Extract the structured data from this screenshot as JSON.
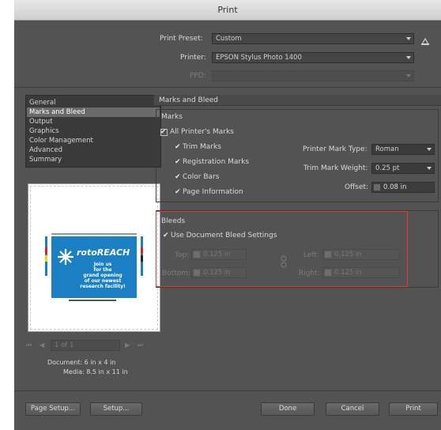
{
  "window": {
    "title": "Print"
  },
  "top": {
    "print_preset_label": "Print Preset:",
    "print_preset_value": "Custom",
    "printer_label": "Printer:",
    "printer_value": "EPSON Stylus Photo 1400",
    "ppd_label": "PPD:",
    "ppd_value": ""
  },
  "categories": [
    "General",
    "Marks and Bleed",
    "Output",
    "Graphics",
    "Color Management",
    "Advanced",
    "Summary"
  ],
  "selected_category": "Marks and Bleed",
  "panel": {
    "title": "Marks and Bleed"
  },
  "marks": {
    "group_label": "Marks",
    "all_printers_marks": {
      "label": "All Printer's Marks",
      "checked": true
    },
    "trim_marks": {
      "label": "Trim Marks",
      "checked": true
    },
    "registration_marks": {
      "label": "Registration Marks",
      "checked": true
    },
    "color_bars": {
      "label": "Color Bars",
      "checked": true
    },
    "page_information": {
      "label": "Page Information",
      "checked": true
    },
    "printer_mark_type_label": "Printer Mark Type:",
    "printer_mark_type_value": "Roman",
    "trim_mark_weight_label": "Trim Mark Weight:",
    "trim_mark_weight_value": "0.25 pt",
    "offset_label": "Offset:",
    "offset_value": "0.08 in"
  },
  "bleeds": {
    "group_label": "Bleeds",
    "use_document": {
      "label": "Use Document Bleed Settings",
      "checked": true
    },
    "top_label": "Top:",
    "top_value": "0.125 in",
    "bottom_label": "Bottom:",
    "bottom_value": "0.125 in",
    "left_label": "Left:",
    "left_value": "0.125 in",
    "right_label": "Right:",
    "right_value": "0.125 in"
  },
  "preview": {
    "logo_text": "rotoREACH",
    "lines": [
      "Join us",
      "for the",
      "grand opening",
      "of our newest",
      "research facility!"
    ],
    "page_field": "1 of 1"
  },
  "document_info": {
    "document": "Document: 6 in x 4 in",
    "media": "Media: 8.5 in x 11 in"
  },
  "buttons": {
    "page_setup": "Page Setup...",
    "setup": "Setup...",
    "done": "Done",
    "cancel": "Cancel",
    "print": "Print"
  },
  "colors": {
    "highlight": "#e23b3b",
    "preview_blue": "#1b7fc4"
  }
}
